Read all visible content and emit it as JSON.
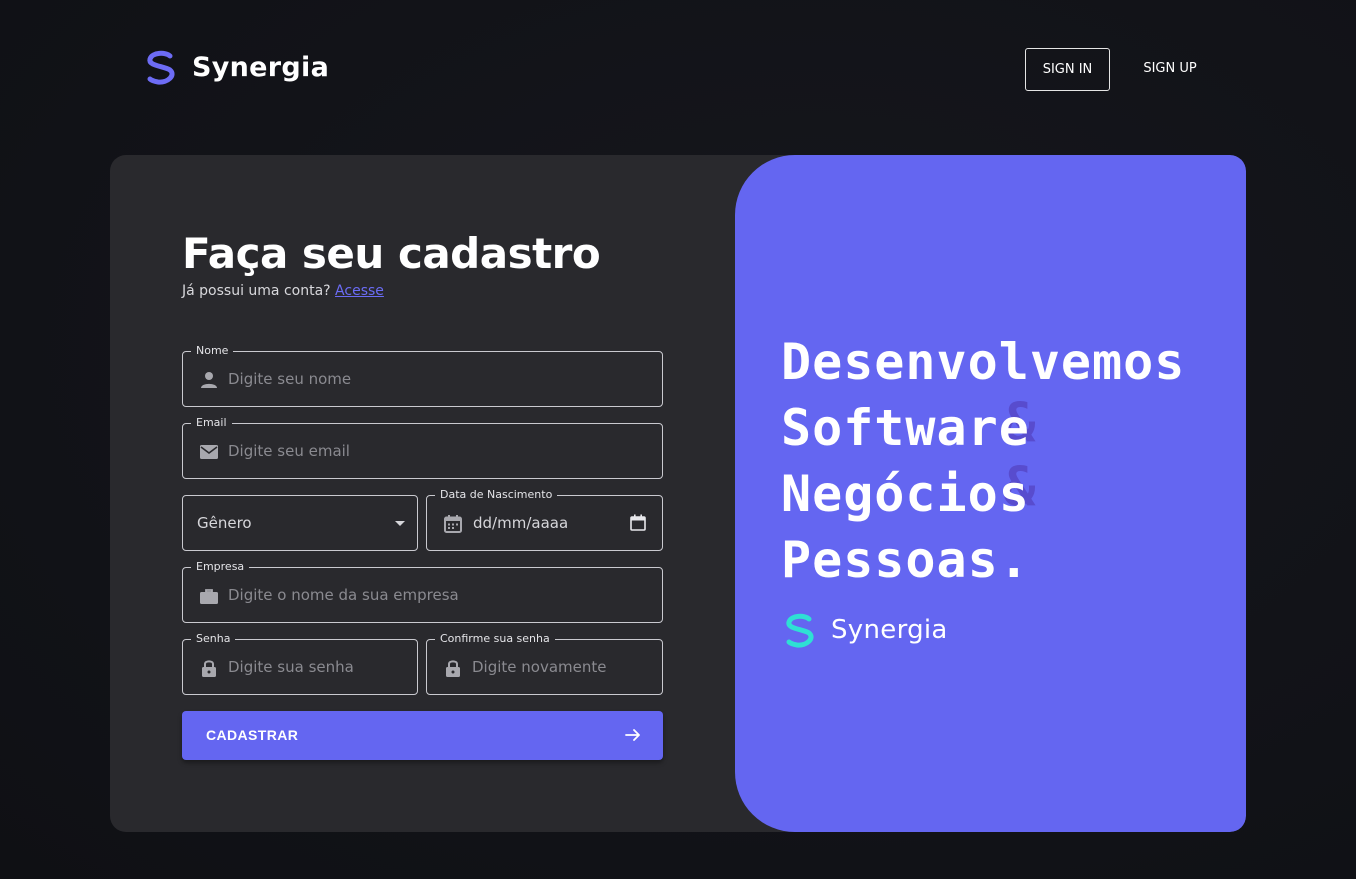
{
  "header": {
    "brand": "Synergia",
    "sign_in": "SIGN IN",
    "sign_up": "SIGN UP"
  },
  "form": {
    "title": "Faça seu cadastro",
    "subtitle": "Já possui uma conta?",
    "login_link": "Acesse",
    "fields": {
      "name": {
        "label": "Nome",
        "placeholder": "Digite seu nome",
        "icon": "person-icon"
      },
      "email": {
        "label": "Email",
        "placeholder": "Digite seu email",
        "icon": "mail-icon"
      },
      "gender": {
        "value": "Gênero",
        "icon": "chevron-down-icon"
      },
      "birthdate": {
        "label": "Data de Nascimento",
        "value": "dd/mm/aaaa",
        "icon": "calendar-icon"
      },
      "company": {
        "label": "Empresa",
        "placeholder": "Digite o nome da sua empresa",
        "icon": "briefcase-icon"
      },
      "password": {
        "label": "Senha",
        "placeholder": "Digite sua senha",
        "icon": "lock-icon"
      },
      "confirm_password": {
        "label": "Confirme sua senha",
        "placeholder": "Digite novamente",
        "icon": "lock-icon"
      }
    },
    "submit": "CADASTRAR"
  },
  "promo": {
    "lines": [
      "Desenvolvemos",
      "Software",
      "Negócios",
      "Pessoas."
    ],
    "ampersand": "&",
    "brand": "Synergia"
  },
  "colors": {
    "accent": "#6466f1",
    "background": "#131419",
    "card": "#29292d",
    "logo_purple": "#6d6cf5",
    "logo_cyan": "#2ee0d4",
    "ampersand": "#5648c9"
  }
}
